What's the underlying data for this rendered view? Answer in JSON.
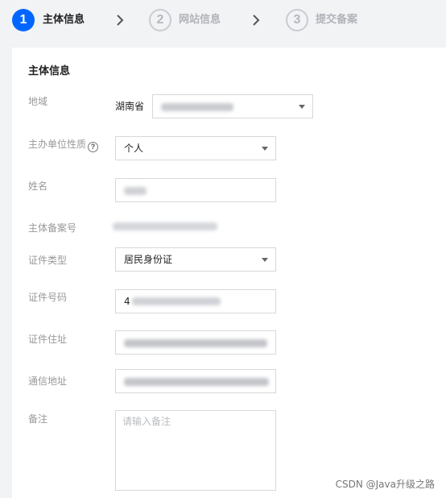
{
  "steps": [
    {
      "number": "1",
      "label": "主体信息",
      "state": "active"
    },
    {
      "number": "2",
      "label": "网站信息",
      "state": "inactive"
    },
    {
      "number": "3",
      "label": "提交备案",
      "state": "inactive"
    }
  ],
  "form": {
    "section_title": "主体信息",
    "region": {
      "label": "地域",
      "province": "湖南省",
      "city_value": ""
    },
    "organizer_type": {
      "label": "主办单位性质",
      "help": "?",
      "value": "个人"
    },
    "name": {
      "label": "姓名",
      "value": ""
    },
    "record_no": {
      "label": "主体备案号",
      "value": ""
    },
    "id_type": {
      "label": "证件类型",
      "value": "居民身份证"
    },
    "id_number": {
      "label": "证件号码",
      "value": "4"
    },
    "id_address": {
      "label": "证件住址",
      "value": ""
    },
    "mail_address": {
      "label": "通信地址",
      "value": ""
    },
    "remark": {
      "label": "备注",
      "placeholder": "请输入备注"
    }
  },
  "watermark": "CSDN @Java升级之路",
  "colors": {
    "accent": "#0066ff",
    "inactive_step": "#b5b8be"
  }
}
